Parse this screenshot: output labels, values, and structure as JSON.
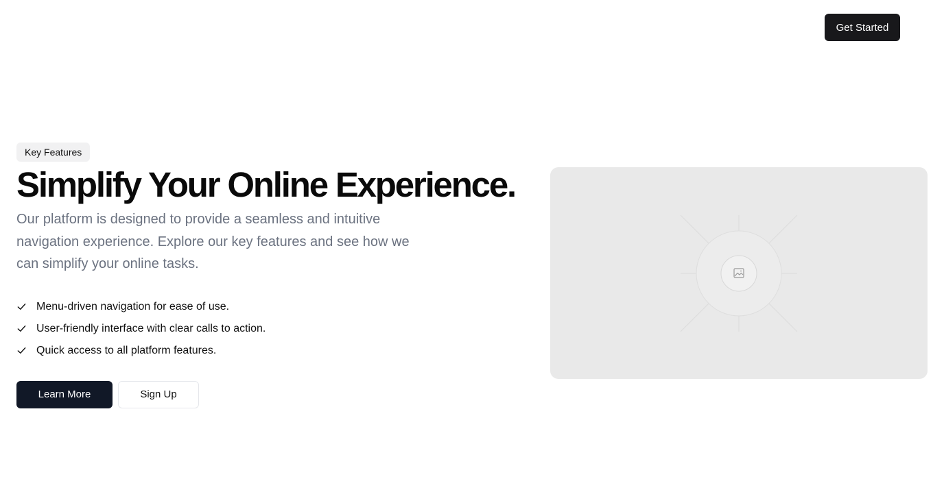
{
  "header": {
    "cta_label": "Get Started"
  },
  "hero": {
    "badge": "Key Features",
    "title": "Simplify Your Online Experience.",
    "description": "Our platform is designed to provide a seamless and intuitive navigation experience. Explore our key features and see how we can simplify your online tasks.",
    "features": [
      "Menu-driven navigation for ease of use.",
      "User-friendly interface with clear calls to action.",
      "Quick access to all platform features."
    ],
    "primary_button": "Learn More",
    "secondary_button": "Sign Up"
  },
  "icons": {
    "feature_check": "check-icon",
    "image_placeholder": "image-icon"
  },
  "colors": {
    "primary_dark": "#111827",
    "header_button": "#18181b",
    "muted_text": "#6b7280",
    "badge_bg": "#f1f1f2",
    "placeholder_bg": "#e9e9e9"
  }
}
